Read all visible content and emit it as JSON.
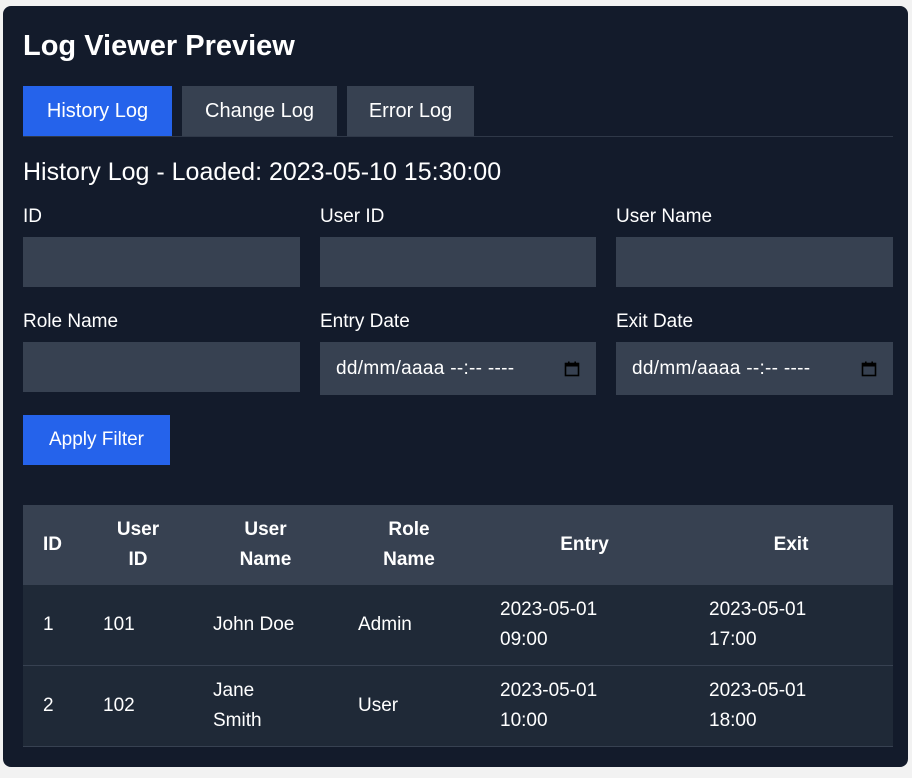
{
  "title": "Log Viewer Preview",
  "tabs": [
    {
      "label": "History Log",
      "active": true
    },
    {
      "label": "Change Log",
      "active": false
    },
    {
      "label": "Error Log",
      "active": false
    }
  ],
  "section_heading": "History Log - Loaded: 2023-05-10 15:30:00",
  "filters": {
    "id": {
      "label": "ID",
      "value": ""
    },
    "user_id": {
      "label": "User ID",
      "value": ""
    },
    "user_name": {
      "label": "User Name",
      "value": ""
    },
    "role_name": {
      "label": "Role Name",
      "value": ""
    },
    "entry_date": {
      "label": "Entry Date",
      "placeholder": "dd/mm/aaaa --:-- ----",
      "icon": "calendar-icon"
    },
    "exit_date": {
      "label": "Exit Date",
      "placeholder": "dd/mm/aaaa --:-- ----",
      "icon": "calendar-icon"
    }
  },
  "apply_button": "Apply Filter",
  "table": {
    "headers": [
      [
        "ID"
      ],
      [
        "User",
        "ID"
      ],
      [
        "User",
        "Name"
      ],
      [
        "Role",
        "Name"
      ],
      [
        "Entry"
      ],
      [
        "Exit"
      ]
    ],
    "rows": [
      [
        [
          "1"
        ],
        [
          "101"
        ],
        [
          "John Doe"
        ],
        [
          "Admin"
        ],
        [
          "2023-05-01",
          "09:00"
        ],
        [
          "2023-05-01",
          "17:00"
        ]
      ],
      [
        [
          "2"
        ],
        [
          "102"
        ],
        [
          "Jane",
          "Smith"
        ],
        [
          "User"
        ],
        [
          "2023-05-01",
          "10:00"
        ],
        [
          "2023-05-01",
          "18:00"
        ]
      ]
    ]
  },
  "colors": {
    "panel_bg": "#131b2b",
    "accent": "#2563eb",
    "input_bg": "#374151",
    "row_bg": "#1f2937"
  }
}
